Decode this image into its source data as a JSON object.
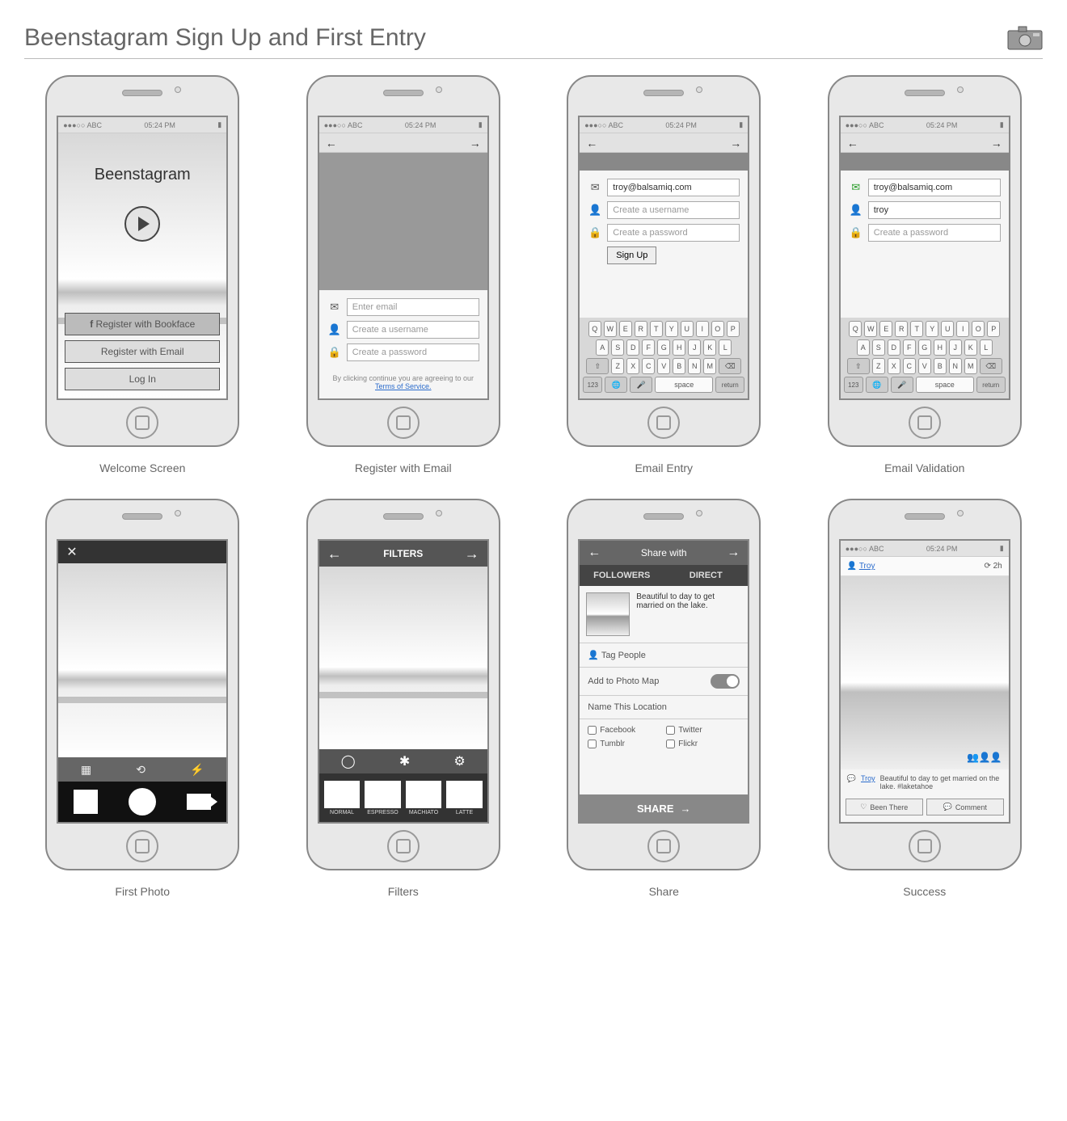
{
  "page": {
    "title": "Beenstagram Sign Up and First Entry"
  },
  "status": {
    "carrier": "ABC",
    "signal": "●●●○○",
    "time": "05:24 PM"
  },
  "captions": [
    "Welcome Screen",
    "Register with Email",
    "Email Entry",
    "Email Validation",
    "First Photo",
    "Filters",
    "Share",
    "Success"
  ],
  "screen1": {
    "appName": "Beenstagram",
    "btn_fb": "Register with Bookface",
    "btn_email": "Register with Email",
    "btn_login": "Log In"
  },
  "screen2": {
    "ph_email": "Enter email",
    "ph_user": "Create a username",
    "ph_pass": "Create a password",
    "tos_pre": "By clicking continue you are agreeing to our ",
    "tos_link": "Terms of Service."
  },
  "screen3": {
    "email": "troy@balsamiq.com",
    "ph_user": "Create a username",
    "ph_pass": "Create a password",
    "signup": "Sign Up"
  },
  "screen4": {
    "email": "troy@balsamiq.com",
    "user": "troy",
    "ph_pass": "Create a password"
  },
  "keyboard": {
    "r1": [
      "Q",
      "W",
      "E",
      "R",
      "T",
      "Y",
      "U",
      "I",
      "O",
      "P"
    ],
    "r2": [
      "A",
      "S",
      "D",
      "F",
      "G",
      "H",
      "J",
      "K",
      "L"
    ],
    "r3": [
      "Z",
      "X",
      "C",
      "V",
      "B",
      "N",
      "M"
    ],
    "num": "123",
    "space": "space",
    "return": "return"
  },
  "filters": {
    "title": "FILTERS",
    "names": [
      "NORMAL",
      "ESPRESSO",
      "MACHIATO",
      "LATTE"
    ]
  },
  "share": {
    "title": "Share with",
    "tab1": "FOLLOWERS",
    "tab2": "DIRECT",
    "caption": "Beautiful to day to get married on the lake.",
    "tag": "Tag People",
    "map": "Add to Photo Map",
    "loc": "Name This Location",
    "opts": [
      "Facebook",
      "Twitter",
      "Tumblr",
      "Flickr"
    ],
    "btn": "SHARE"
  },
  "success": {
    "user": "Troy",
    "time": "2h",
    "caption": "Beautiful to day to get married on the lake. #laketahoe",
    "btn1": "Been There",
    "btn2": "Comment"
  }
}
